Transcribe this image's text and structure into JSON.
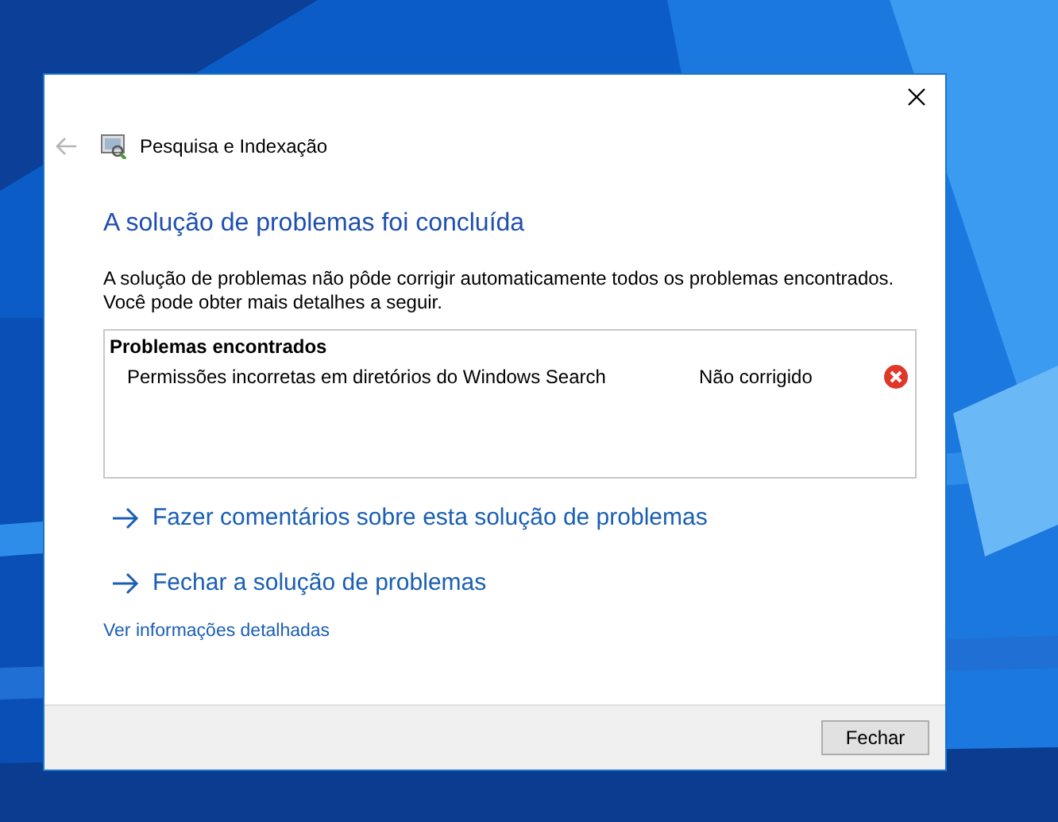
{
  "window": {
    "title": "Pesquisa e Indexação"
  },
  "heading": "A solução de problemas foi concluída",
  "message": "A solução de problemas não pôde corrigir automaticamente todos os problemas encontrados. Você pode obter mais detalhes a seguir.",
  "problems": {
    "title": "Problemas encontrados",
    "items": [
      {
        "name": "Permissões incorretas em diretórios do Windows Search",
        "status": "Não corrigido",
        "fixed": false
      }
    ]
  },
  "links": [
    {
      "label": "Fazer comentários sobre esta solução de problemas"
    },
    {
      "label": "Fechar a solução de problemas"
    }
  ],
  "details_link": "Ver informações detalhadas",
  "buttons": [
    "Fechar"
  ]
}
